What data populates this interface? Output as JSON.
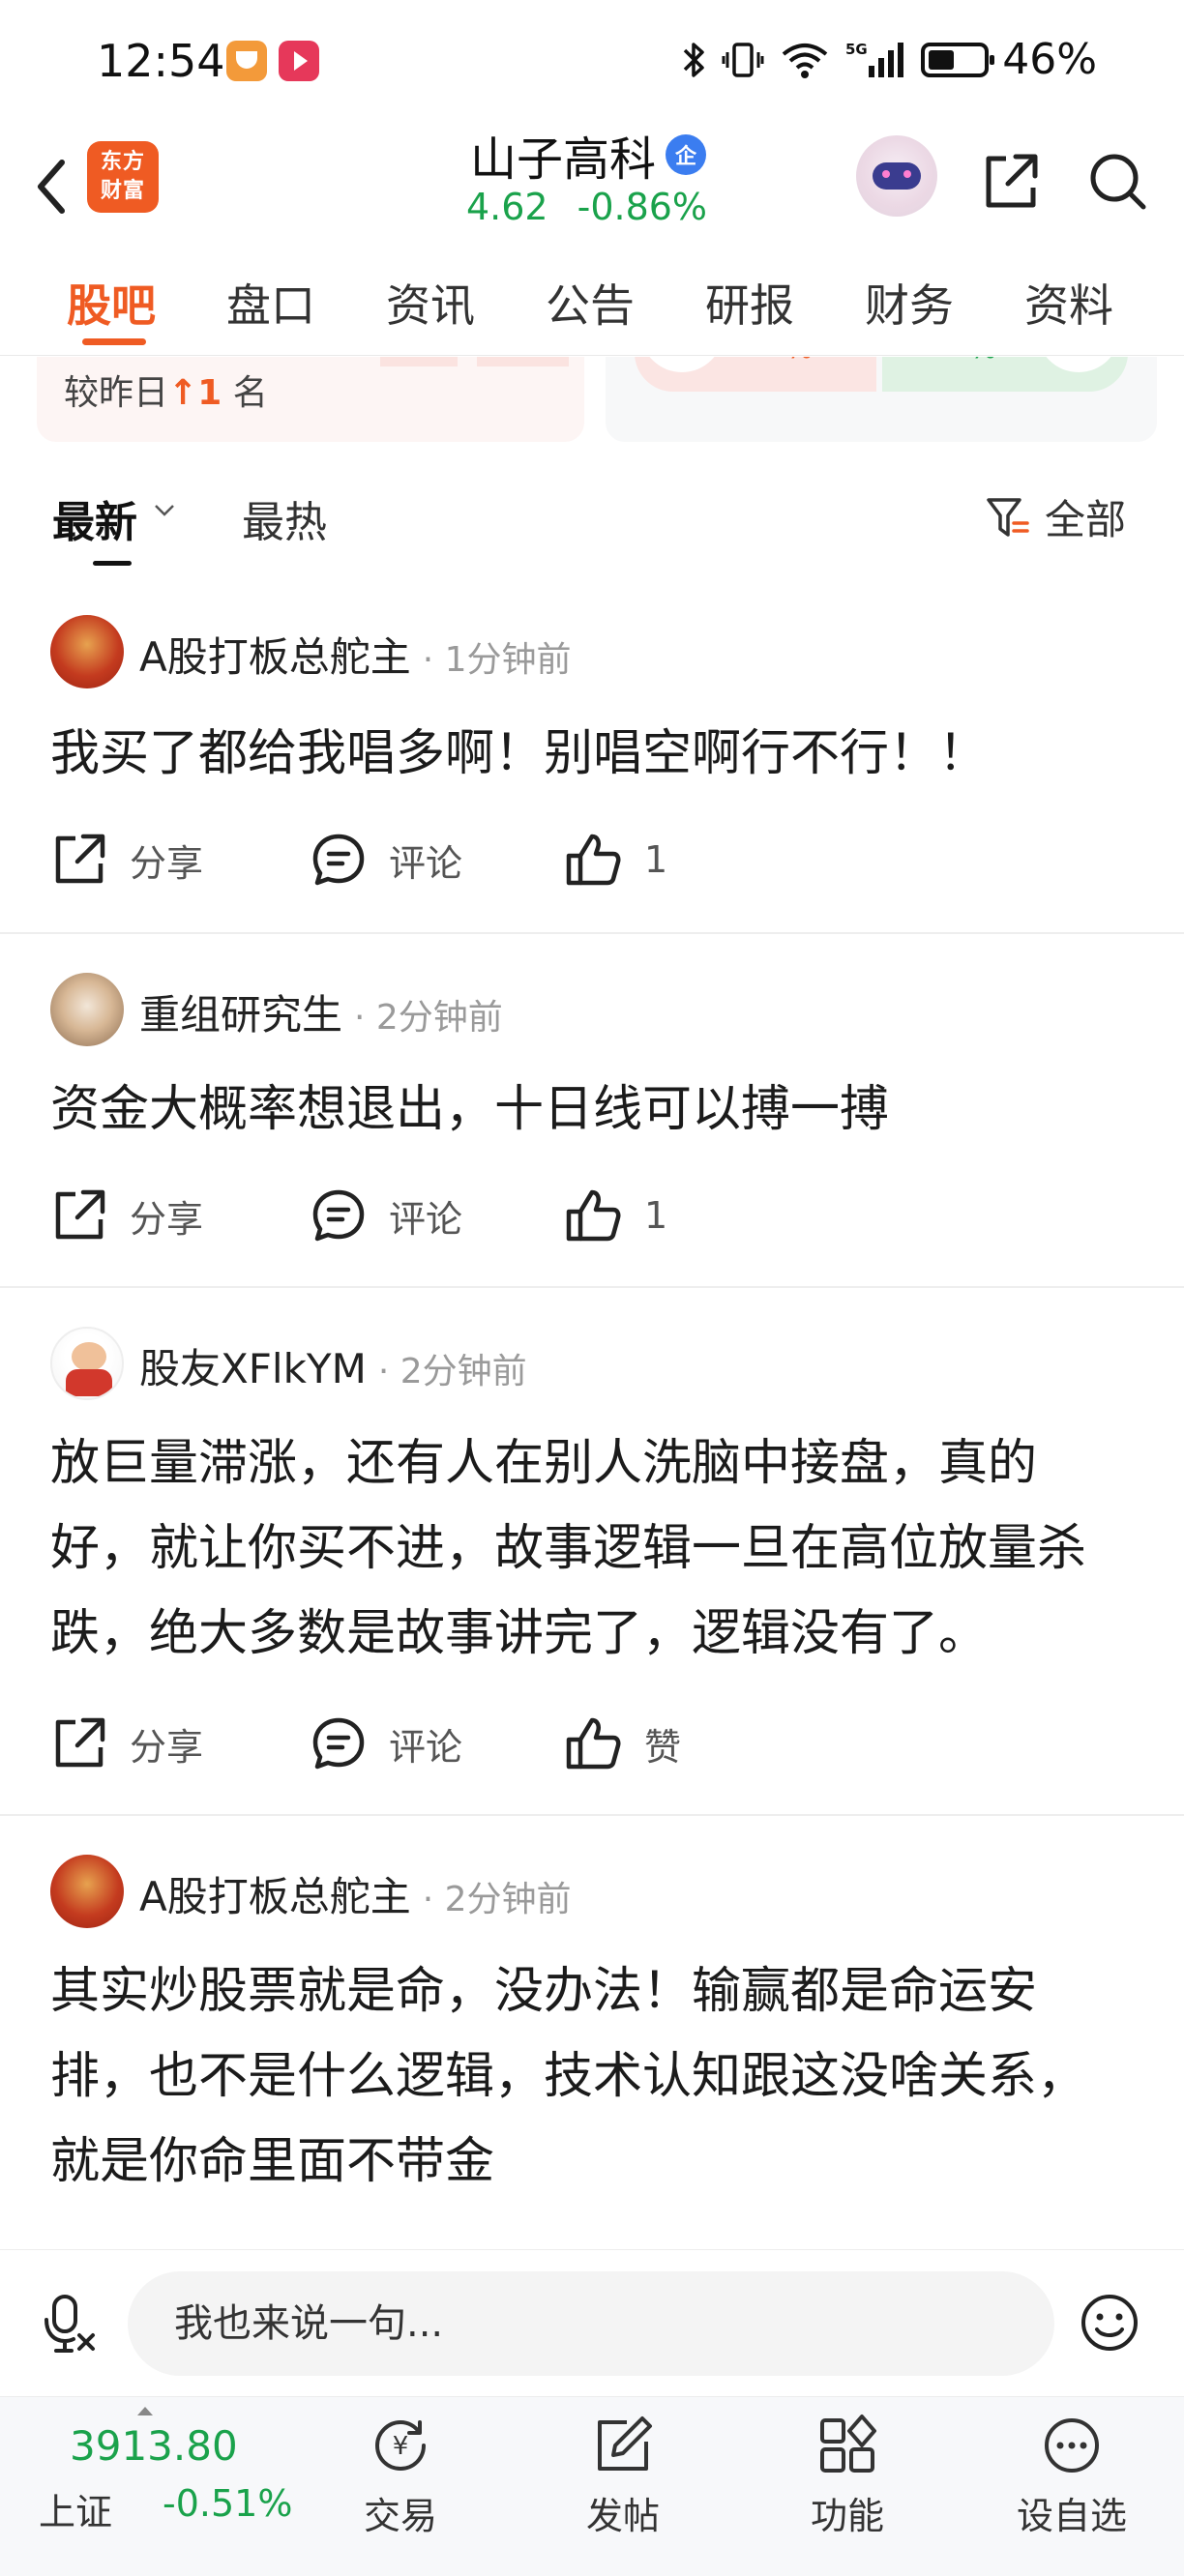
{
  "status_bar": {
    "time": "12:54",
    "battery": "46%",
    "network": "5G"
  },
  "header": {
    "logo_line1": "东方",
    "logo_line2": "财富",
    "stock_name": "山子高科",
    "badge": "企",
    "price": "4.62",
    "change": "-0.86%"
  },
  "tabs": [
    "股吧",
    "盘口",
    "资讯",
    "公告",
    "研报",
    "财务",
    "资料"
  ],
  "rank_card": {
    "prefix": "较昨日",
    "arrow": "↑",
    "num": "1",
    "suffix": "名",
    "red_pct": "**%",
    "green_pct": "**%"
  },
  "filter": {
    "latest": "最新",
    "hot": "最热",
    "all": "全部"
  },
  "posts": [
    {
      "author": "A股打板总舵主",
      "time": "· 1分钟前",
      "text": "我买了都给我唱多啊！别唱空啊行不行！！",
      "share": "分享",
      "comment": "评论",
      "likes": "1"
    },
    {
      "author": "重组研究生",
      "time": "· 2分钟前",
      "text": "资金大概率想退出，十日线可以搏一搏",
      "share": "分享",
      "comment": "评论",
      "likes": "1"
    },
    {
      "author": "股友XFlkYM",
      "time": "· 2分钟前",
      "text": "放巨量滞涨，还有人在别人洗脑中接盘，真的好，就让你买不进，故事逻辑一旦在高位放量杀跌，绝大多数是故事讲完了，逻辑没有了。",
      "share": "分享",
      "comment": "评论",
      "likes": "赞"
    },
    {
      "author": "A股打板总舵主",
      "time": "· 2分钟前",
      "text": "其实炒股票就是命，没办法！输赢都是命运安排，也不是什么逻辑，技术认知跟这没啥关系，就是你命里面不带金"
    }
  ],
  "comment_bar": {
    "placeholder": "我也来说一句..."
  },
  "bottom_nav": {
    "index_value": "3913.80",
    "index_name": "上证",
    "index_change": "-0.51%",
    "items": [
      "交易",
      "发帖",
      "功能",
      "设自选"
    ]
  },
  "colors": {
    "accent": "#ef5b23",
    "down_green": "#1aa24b"
  }
}
